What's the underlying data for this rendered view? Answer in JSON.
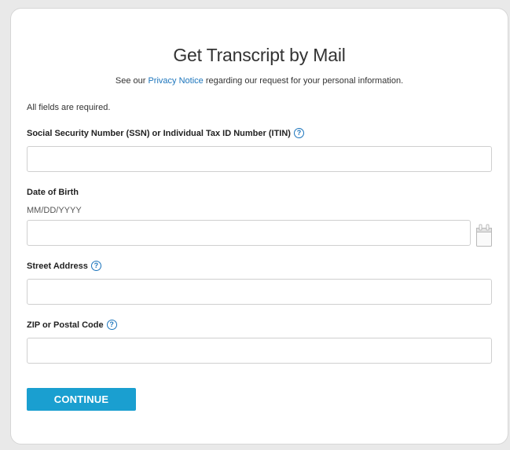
{
  "page": {
    "title": "Get Transcript by Mail",
    "subtitle_before": "See our ",
    "subtitle_link": "Privacy Notice",
    "subtitle_after": " regarding our request for your personal information.",
    "required_note": "All fields are required."
  },
  "form": {
    "ssn": {
      "label": "Social Security Number (SSN) or Individual Tax ID Number (ITIN)",
      "value": ""
    },
    "dob": {
      "label": "Date of Birth",
      "hint": "MM/DD/YYYY",
      "value": ""
    },
    "street": {
      "label": "Street Address",
      "value": ""
    },
    "zip": {
      "label": "ZIP or Postal Code",
      "value": ""
    },
    "help_symbol": "?",
    "continue_label": "CONTINUE"
  },
  "icons": {
    "help": "question-circle-icon",
    "calendar": "calendar-icon"
  },
  "colors": {
    "link": "#1c75bc",
    "button": "#1a9fd0",
    "button_text": "#ffffff",
    "field_border": "#cfcfcf",
    "background": "#e9e9e9"
  }
}
